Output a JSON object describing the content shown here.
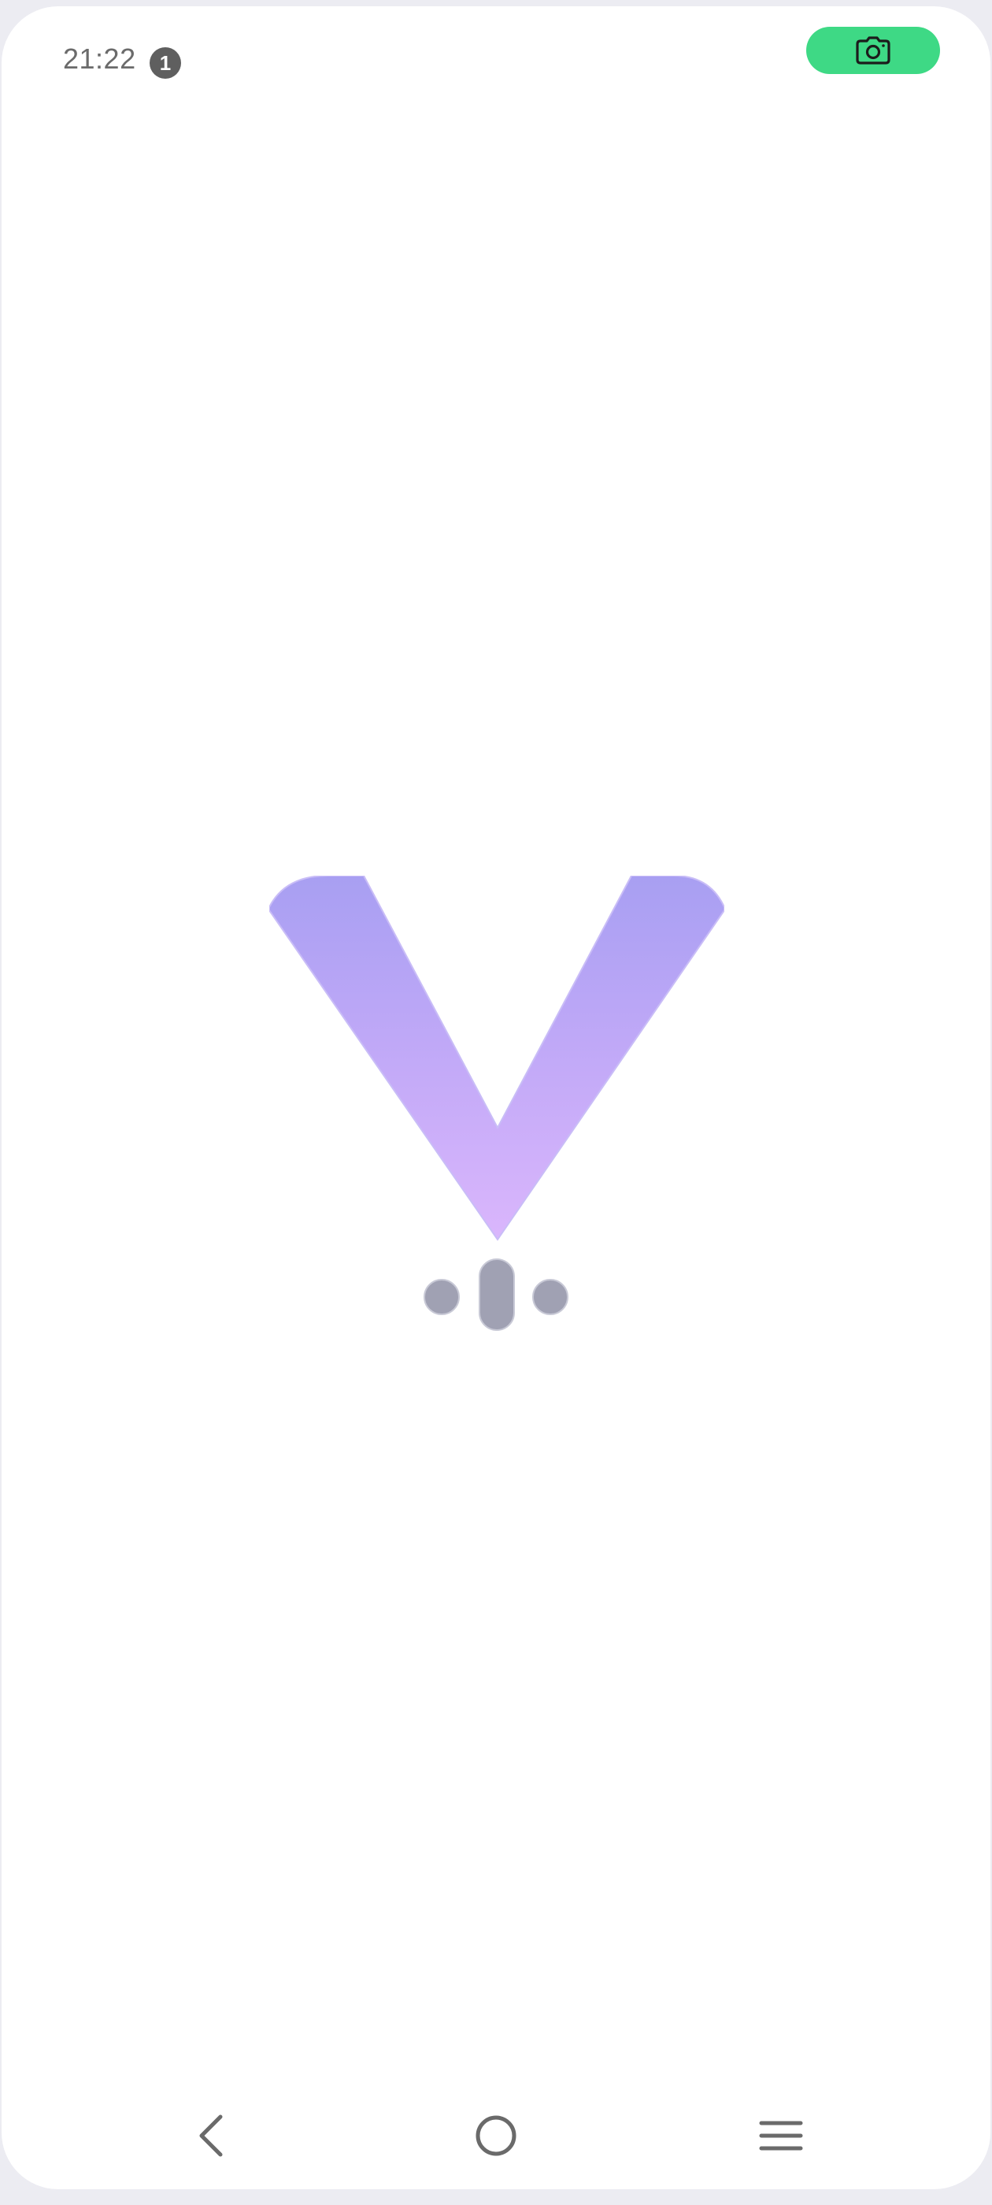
{
  "status_bar": {
    "time": "21:22",
    "notification_count": "1",
    "camera_indicator_color": "#3ed985",
    "camera_icon": "camera-icon"
  },
  "splash": {
    "logo_icon": "v-logo-icon",
    "logo_gradient_top": "#a89ff2",
    "logo_gradient_bottom": "#d7b3fb",
    "loader_color": "#a0a1b3"
  },
  "navigation": {
    "back_icon": "back-chevron-icon",
    "home_icon": "home-circle-icon",
    "menu_icon": "menu-lines-icon"
  }
}
